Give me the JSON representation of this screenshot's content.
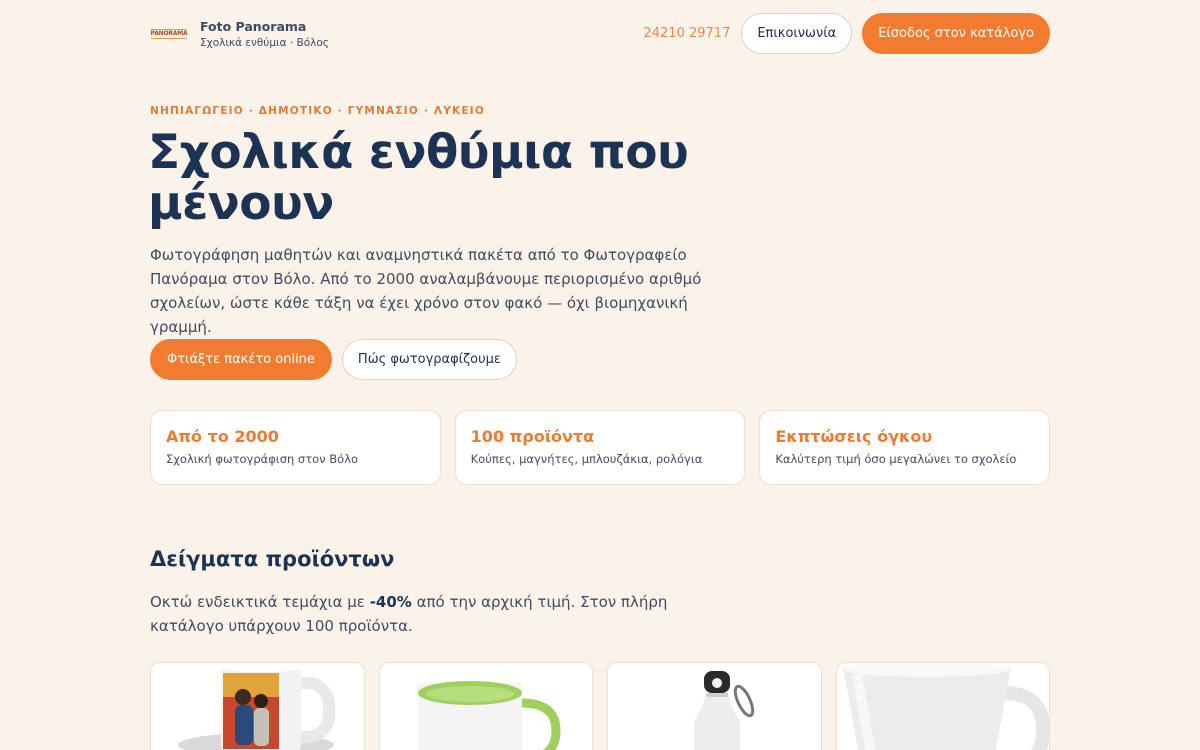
{
  "header": {
    "logo_text": "PANORAMA",
    "brand_name": "Foto Panorama",
    "brand_sub": "Σχολικά ενθύμια · Βόλος",
    "phone": "24210 29717",
    "contact_label": "Επικοινωνία",
    "catalog_label": "Είσοδος στον κατάλογο"
  },
  "hero": {
    "eyebrow": "ΝΗΠΙΑΓΩΓΕΙΟ · ΔΗΜΟΤΙΚΟ · ΓΥΜΝΑΣΙΟ · ΛΥΚΕΙΟ",
    "title": "Σχολικά ενθύμια που μένουν",
    "description": "Φωτογράφηση μαθητών και αναμνηστικά πακέτα από το Φωτογραφείο Πανόραμα στον Βόλο. Από το 2000 αναλαμβάνουμε περιορισμένο αριθμό σχολείων, ώστε κάθε τάξη να έχει χρόνο στον φακό — όχι βιομηχανική γραμμή.",
    "primary_cta": "Φτιάξτε πακέτο online",
    "secondary_cta": "Πώς φωτογραφίζουμε"
  },
  "features": [
    {
      "title": "Από το 2000",
      "sub": "Σχολική φωτογράφιση στον Βόλο"
    },
    {
      "title": "100 προϊόντα",
      "sub": "Κούπες, μαγνήτες, μπλουζάκια, ρολόγια"
    },
    {
      "title": "Εκπτώσεις όγκου",
      "sub": "Καλύτερη τιμή όσο μεγαλώνει το σχολείο"
    }
  ],
  "samples": {
    "title": "Δείγματα προϊόντων",
    "desc_before": "Οκτώ ενδεικτικά τεμάχια με ",
    "desc_discount": "-40%",
    "desc_after": " από την αρχική τιμή. Στον πλήρη κατάλογο υπάρχουν 100 προϊόντα."
  },
  "products": [
    {
      "icon": "photo-mug-icon"
    },
    {
      "icon": "green-mug-icon"
    },
    {
      "icon": "water-bottle-icon"
    },
    {
      "icon": "latte-mug-icon"
    }
  ],
  "colors": {
    "accent": "#f27b2f",
    "navy": "#1c3355",
    "background": "#fbf3ea"
  }
}
